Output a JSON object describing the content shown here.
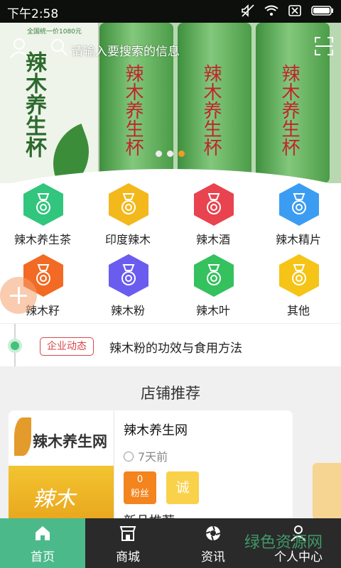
{
  "status_bar": {
    "time": "下午2:58",
    "battery_icon": "battery-icon",
    "wifi_icon": "wifi-icon"
  },
  "banner": {
    "box_title": "辣木养生杯",
    "box_small": "全国统一价1080元",
    "can_label": "辣木养生杯",
    "dots_count": 3,
    "active_dot": 3
  },
  "search": {
    "placeholder": "请输入要搜索的信息"
  },
  "categories": [
    {
      "label": "辣木养生茶",
      "color": "#32c57d"
    },
    {
      "label": "印度辣木",
      "color": "#f3b81c"
    },
    {
      "label": "辣木酒",
      "color": "#e8434f"
    },
    {
      "label": "辣木精片",
      "color": "#3b9df2"
    },
    {
      "label": "辣木籽",
      "color": "#f26a24"
    },
    {
      "label": "辣木粉",
      "color": "#6b5cf0"
    },
    {
      "label": "辣木叶",
      "color": "#34c15e"
    },
    {
      "label": "其他",
      "color": "#f5c416"
    }
  ],
  "news": {
    "tag": "企业动态",
    "headline": "辣木粉的功效与食用方法"
  },
  "stores": {
    "section_title": "店铺推荐",
    "card": {
      "logo_name": "辣木养生网",
      "package_text": "辣木",
      "shop_name": "辣木养生网",
      "time_ago": "7天前",
      "fans_count": "0",
      "fans_label": "粉丝",
      "cheng_label": "诚",
      "more_text": "新品推荐"
    }
  },
  "tabs": [
    {
      "label": "首页",
      "icon": "home-icon",
      "active": true
    },
    {
      "label": "商城",
      "icon": "store-icon",
      "active": false
    },
    {
      "label": "资讯",
      "icon": "aperture-icon",
      "active": false
    },
    {
      "label": "个人中心",
      "icon": "person-icon",
      "active": false
    }
  ],
  "watermark": "绿色资源网",
  "colors": {
    "accent": "#4cb98b",
    "tag_red": "#d8464a",
    "fans_orange": "#f3841e"
  }
}
